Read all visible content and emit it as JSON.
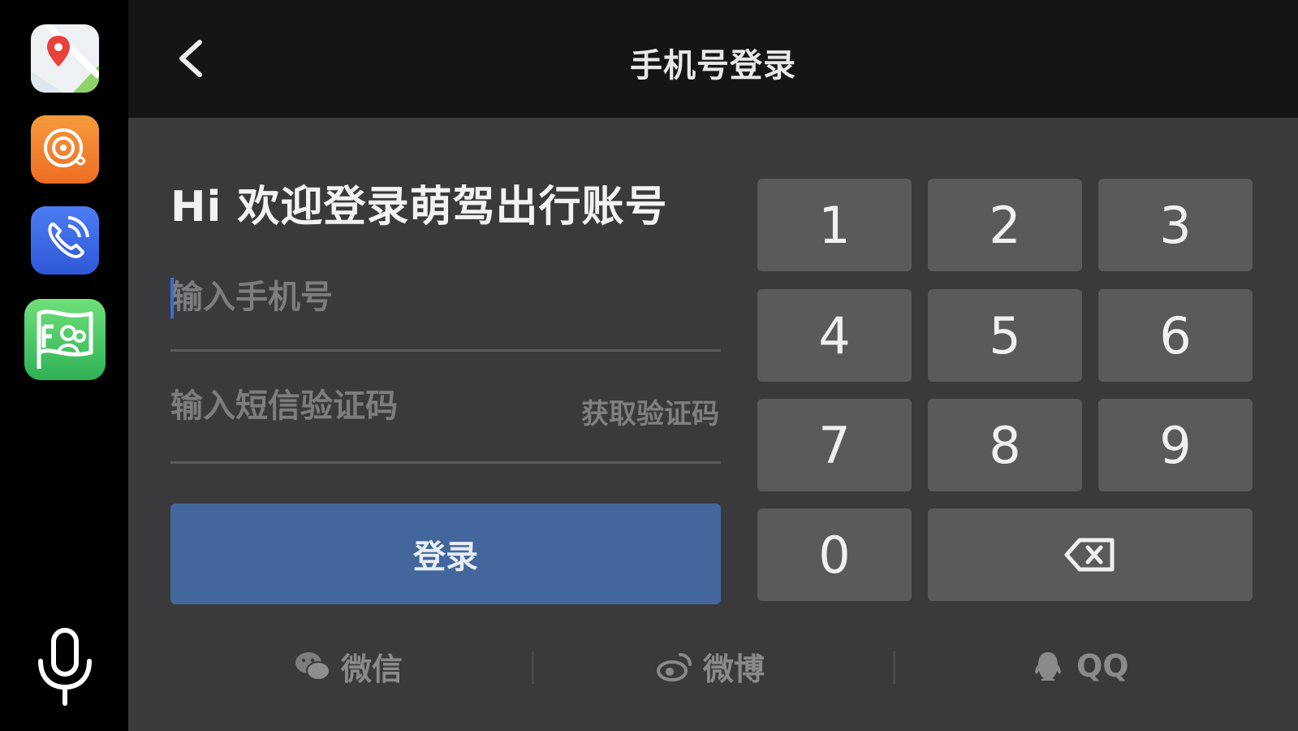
{
  "dock": {
    "apps": [
      {
        "name": "maps-app-icon"
      },
      {
        "name": "music-app-icon"
      },
      {
        "name": "phone-app-icon"
      },
      {
        "name": "fleet-app-icon"
      }
    ]
  },
  "header": {
    "title": "手机号登录"
  },
  "login": {
    "welcome": "Hi 欢迎登录萌驾出行账号",
    "phone_placeholder": "输入手机号",
    "phone_value": "",
    "code_placeholder": "输入短信验证码",
    "code_value": "",
    "get_code_label": "获取验证码",
    "login_label": "登录"
  },
  "keypad": {
    "keys": [
      "1",
      "2",
      "3",
      "4",
      "5",
      "6",
      "7",
      "8",
      "9",
      "0"
    ]
  },
  "social": {
    "wechat": "微信",
    "weibo": "微博",
    "qq": "QQ"
  },
  "colors": {
    "dock_bg": "#000000",
    "header_bg": "#151517",
    "panel_bg": "#3a3a3c",
    "key_bg": "#5a5a5c",
    "login_button": "#43669d",
    "caret": "#3f6bd8"
  }
}
